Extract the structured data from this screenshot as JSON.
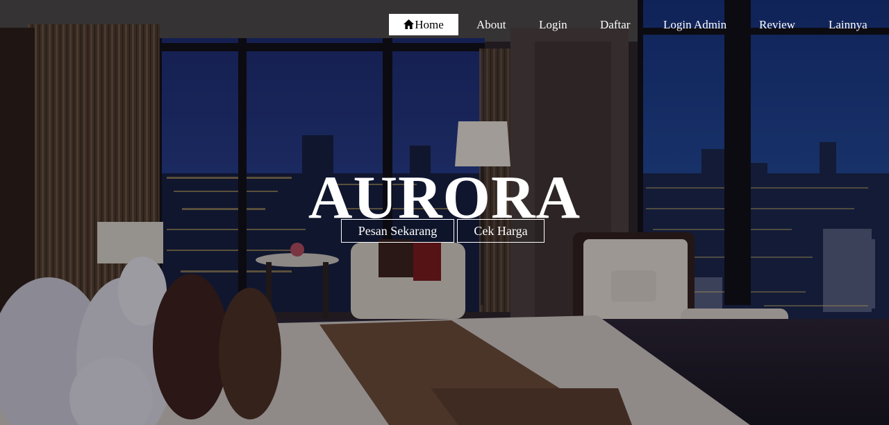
{
  "nav": {
    "items": [
      {
        "label": "Home",
        "icon": "home-icon",
        "active": true
      },
      {
        "label": "About"
      },
      {
        "label": "Login"
      },
      {
        "label": "Daftar"
      },
      {
        "label": "Login Admin"
      },
      {
        "label": "Review"
      },
      {
        "label": "Lainnya"
      }
    ]
  },
  "hero": {
    "brand": "AURORA",
    "cta_primary": "Pesan Sekarang",
    "cta_secondary": "Cek Harga"
  },
  "colors": {
    "text": "#ffffff",
    "active_nav_bg": "#ffffff",
    "active_nav_text": "#000000"
  }
}
